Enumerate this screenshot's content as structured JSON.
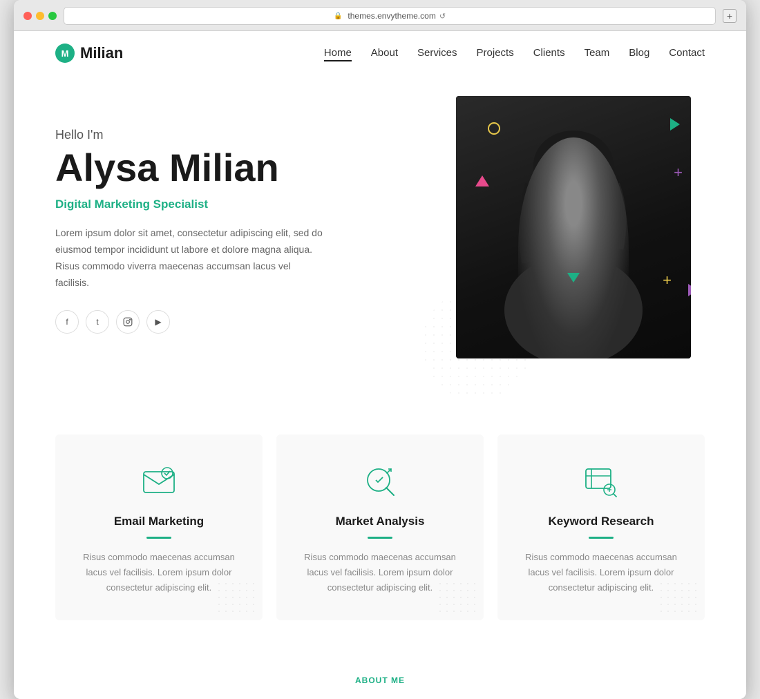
{
  "browser": {
    "url": "themes.envytheme.com",
    "new_tab_label": "+"
  },
  "nav": {
    "logo_letter": "M",
    "logo_name": "Milian",
    "links": [
      {
        "label": "Home",
        "active": true
      },
      {
        "label": "About",
        "active": false
      },
      {
        "label": "Services",
        "active": false
      },
      {
        "label": "Projects",
        "active": false
      },
      {
        "label": "Clients",
        "active": false
      },
      {
        "label": "Team",
        "active": false
      },
      {
        "label": "Blog",
        "active": false
      },
      {
        "label": "Contact",
        "active": false
      }
    ]
  },
  "hero": {
    "greeting": "Hello I'm",
    "name": "Alysa Milian",
    "title": "Digital Marketing Specialist",
    "description": "Lorem ipsum dolor sit amet, consectetur adipiscing elit, sed do eiusmod tempor incididunt ut labore et dolore magna aliqua. Risus commodo viverra maecenas accumsan lacus vel facilisis.",
    "social": [
      {
        "name": "facebook",
        "label": "f"
      },
      {
        "name": "twitter",
        "label": "t"
      },
      {
        "name": "instagram",
        "label": "in"
      },
      {
        "name": "youtube",
        "label": "▶"
      }
    ]
  },
  "services": [
    {
      "id": "email-marketing",
      "title": "Email Marketing",
      "description": "Risus commodo maecenas accumsan lacus vel facilisis. Lorem ipsum dolor consectetur adipiscing elit."
    },
    {
      "id": "market-analysis",
      "title": "Market Analysis",
      "description": "Risus commodo maecenas accumsan lacus vel facilisis. Lorem ipsum dolor consectetur adipiscing elit."
    },
    {
      "id": "keyword-research",
      "title": "Keyword Research",
      "description": "Risus commodo maecenas accumsan lacus vel facilisis. Lorem ipsum dolor consectetur adipiscing elit."
    }
  ],
  "footer": {
    "cta_label": "ABOUT ME"
  },
  "colors": {
    "accent": "#1db085",
    "dark": "#1a1a1a",
    "text_muted": "#888888"
  }
}
